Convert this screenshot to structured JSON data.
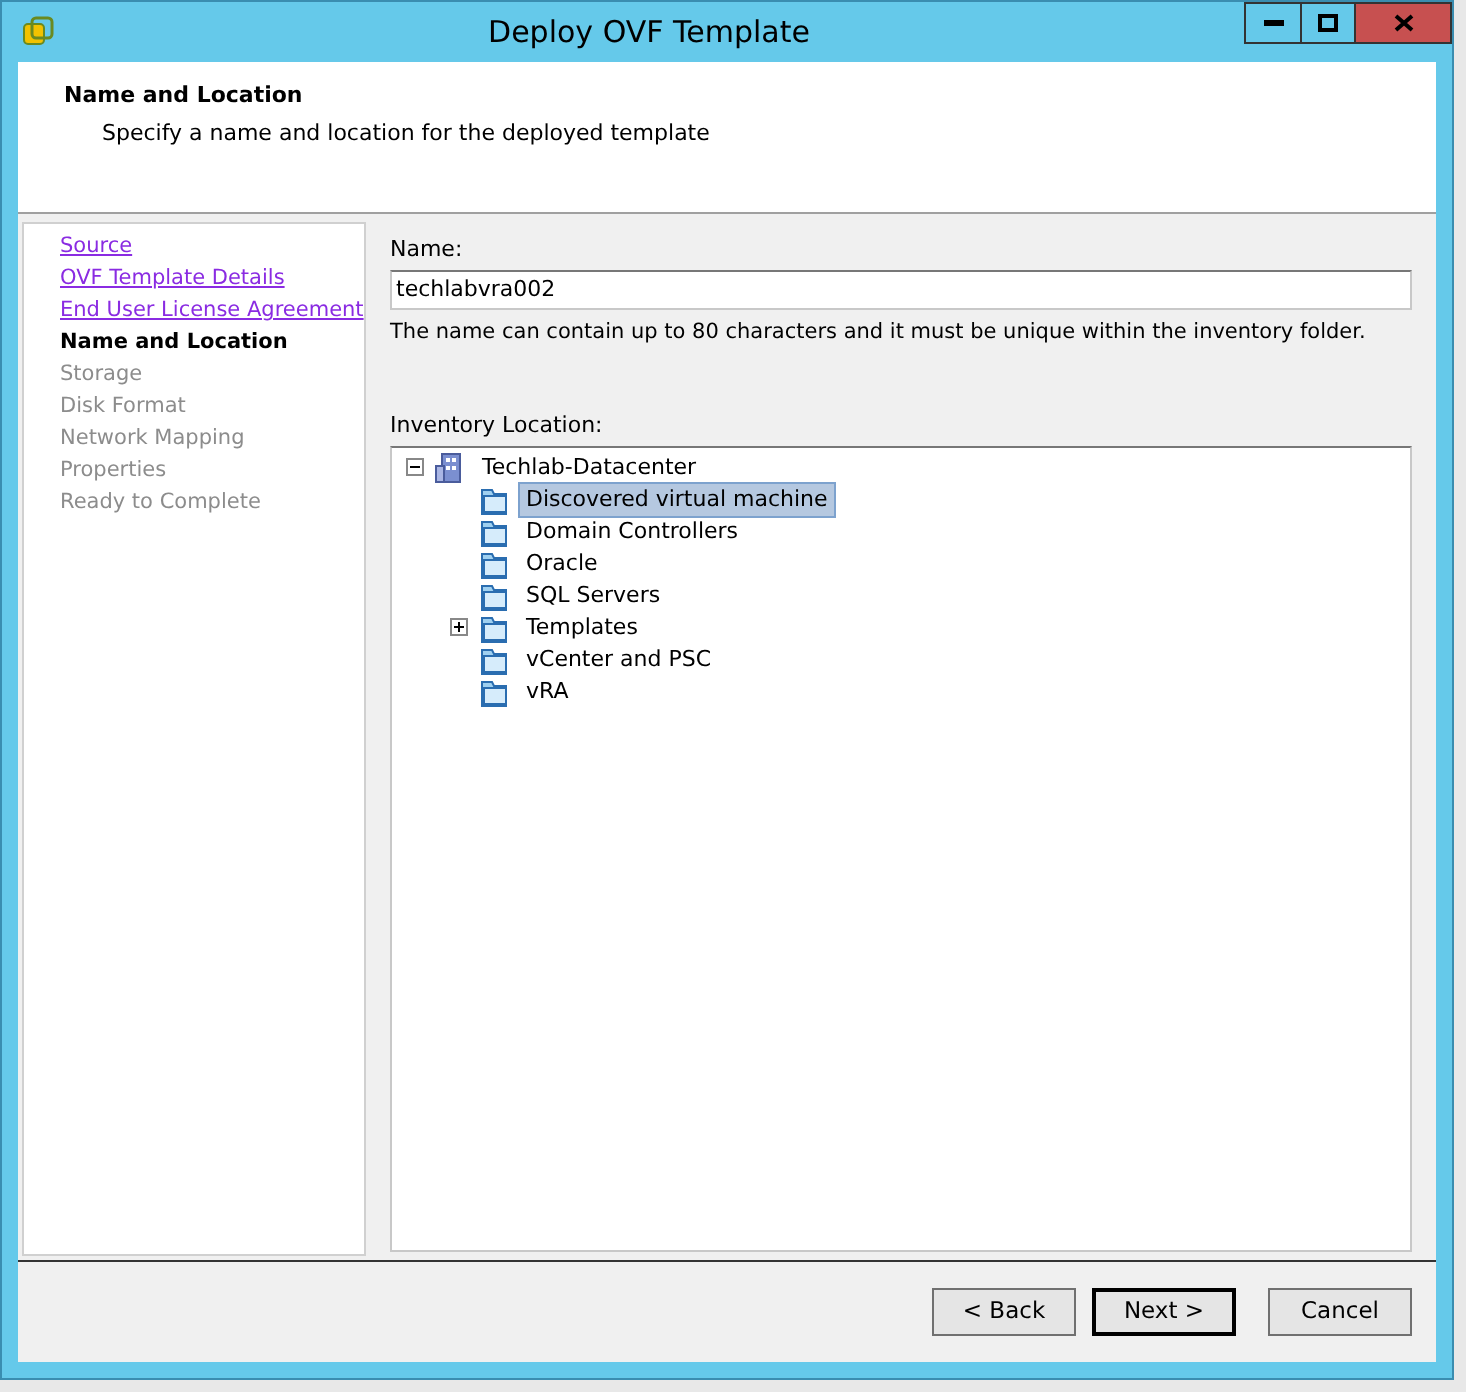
{
  "window": {
    "title": "Deploy OVF Template"
  },
  "header": {
    "title": "Name and Location",
    "subtitle": "Specify a name and location for the deployed template"
  },
  "steps": [
    {
      "label": "Source",
      "kind": "visited"
    },
    {
      "label": "OVF Template Details",
      "kind": "visited"
    },
    {
      "label": "End User License Agreement",
      "kind": "visited"
    },
    {
      "label": "Name and Location",
      "kind": "current"
    },
    {
      "label": "Storage",
      "kind": "pending"
    },
    {
      "label": "Disk Format",
      "kind": "pending"
    },
    {
      "label": "Network Mapping",
      "kind": "pending"
    },
    {
      "label": "Properties",
      "kind": "pending"
    },
    {
      "label": "Ready to Complete",
      "kind": "pending"
    }
  ],
  "name_field": {
    "label": "Name:",
    "value": "techlabvra002",
    "hint": "The name can contain up to 80 characters and it must be unique within the inventory folder."
  },
  "inventory": {
    "label": "Inventory Location:",
    "tree": [
      {
        "label": "Techlab-Datacenter",
        "kind": "datacenter",
        "expanded": true,
        "selected": false,
        "children": [
          {
            "label": "Discovered virtual machine",
            "kind": "folder",
            "selected": true
          },
          {
            "label": "Domain Controllers",
            "kind": "folder",
            "selected": false
          },
          {
            "label": "Oracle",
            "kind": "folder",
            "selected": false
          },
          {
            "label": "SQL Servers",
            "kind": "folder",
            "selected": false
          },
          {
            "label": "Templates",
            "kind": "folder",
            "selected": false,
            "expanded": false
          },
          {
            "label": "vCenter and PSC",
            "kind": "folder",
            "selected": false
          },
          {
            "label": "vRA",
            "kind": "folder",
            "selected": false
          }
        ]
      }
    ]
  },
  "buttons": [
    {
      "label": "< Back",
      "default": false
    },
    {
      "label": "Next >",
      "default": true
    },
    {
      "label": "Cancel",
      "default": false
    }
  ]
}
